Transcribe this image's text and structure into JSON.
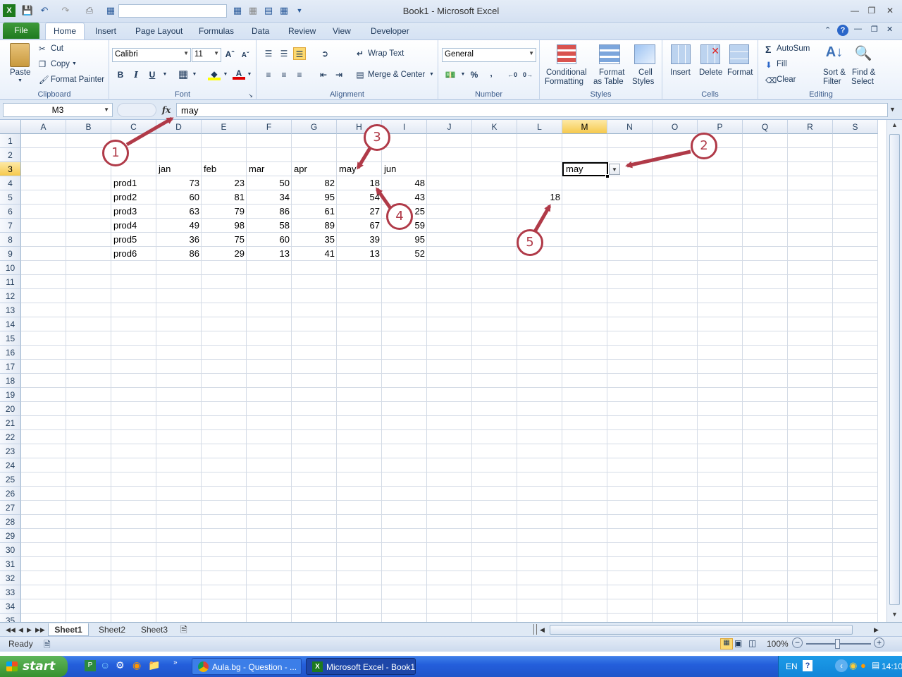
{
  "window": {
    "title": "Book1  -  Microsoft Excel"
  },
  "ribbon_tabs": [
    "File",
    "Home",
    "Insert",
    "Page Layout",
    "Formulas",
    "Data",
    "Review",
    "View",
    "Developer"
  ],
  "clipboard": {
    "paste": "Paste",
    "cut": "Cut",
    "copy": "Copy",
    "format_painter": "Format Painter",
    "label": "Clipboard"
  },
  "font": {
    "name": "Calibri",
    "size": "11",
    "bold": "B",
    "italic": "I",
    "underline": "U",
    "label": "Font"
  },
  "alignment": {
    "wrap_text": "Wrap Text",
    "merge_center": "Merge & Center",
    "label": "Alignment"
  },
  "number": {
    "format": "General",
    "percent": "%",
    "comma": ",",
    "label": "Number"
  },
  "styles": {
    "conditional_1": "Conditional",
    "conditional_2": "Formatting",
    "format_table_1": "Format",
    "format_table_2": "as Table",
    "cell_styles_1": "Cell",
    "cell_styles_2": "Styles",
    "label": "Styles"
  },
  "cells_group": {
    "insert": "Insert",
    "delete": "Delete",
    "format": "Format",
    "label": "Cells"
  },
  "editing": {
    "autosum": "AutoSum",
    "fill": "Fill",
    "clear": "Clear",
    "sort_1": "Sort &",
    "sort_2": "Filter",
    "find_1": "Find &",
    "find_2": "Select",
    "label": "Editing"
  },
  "formula_bar": {
    "name_box": "M3",
    "fx": "fx",
    "value": "may"
  },
  "columns": [
    "A",
    "B",
    "C",
    "D",
    "E",
    "F",
    "G",
    "H",
    "I",
    "J",
    "K",
    "L",
    "M",
    "N",
    "O",
    "P",
    "Q",
    "R",
    "S"
  ],
  "selected_column": "M",
  "selected_row": "3",
  "sheet": {
    "months": [
      "jan",
      "feb",
      "mar",
      "apr",
      "may",
      "jun"
    ],
    "products": [
      {
        "name": "prod1",
        "values": [
          "73",
          "23",
          "50",
          "82",
          "18",
          "48"
        ]
      },
      {
        "name": "prod2",
        "values": [
          "60",
          "81",
          "34",
          "95",
          "54",
          "43"
        ]
      },
      {
        "name": "prod3",
        "values": [
          "63",
          "79",
          "86",
          "61",
          "27",
          "25"
        ]
      },
      {
        "name": "prod4",
        "values": [
          "49",
          "98",
          "58",
          "89",
          "67",
          "59"
        ]
      },
      {
        "name": "prod5",
        "values": [
          "36",
          "75",
          "60",
          "35",
          "39",
          "95"
        ]
      },
      {
        "name": "prod6",
        "values": [
          "86",
          "29",
          "13",
          "41",
          "13",
          "52"
        ]
      }
    ],
    "dropdown_value": "may",
    "result_value": "18"
  },
  "annotations": [
    "1",
    "2",
    "3",
    "4",
    "5"
  ],
  "sheet_tabs": [
    "Sheet1",
    "Sheet2",
    "Sheet3"
  ],
  "status": {
    "ready": "Ready",
    "zoom": "100%"
  },
  "taskbar": {
    "start": "start",
    "items": [
      "Aula.bg - Question - ...",
      "Microsoft Excel - Book1"
    ],
    "lang": "EN",
    "time": "14:10"
  }
}
